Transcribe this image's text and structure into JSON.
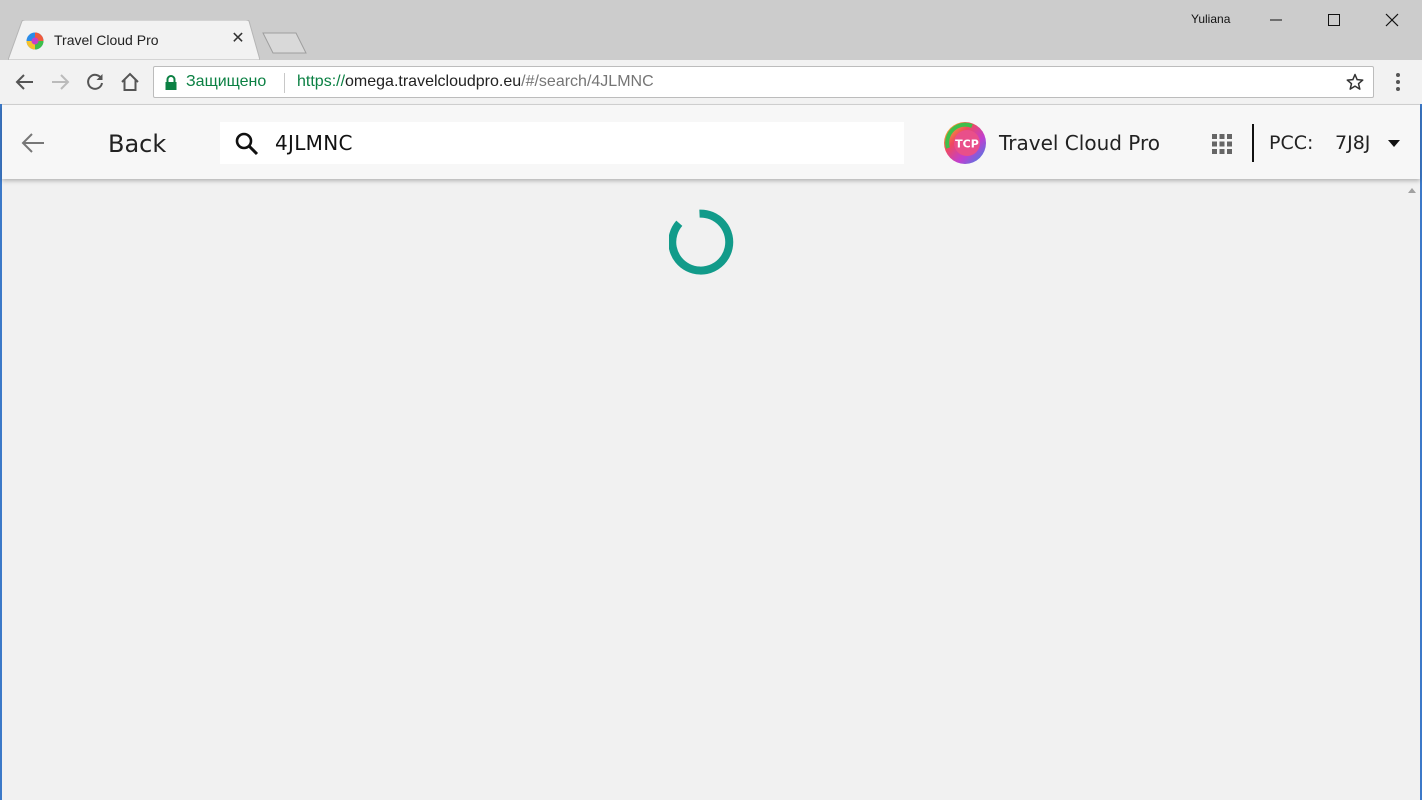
{
  "browser": {
    "tab_title": "Travel Cloud Pro",
    "profile_name": "Yuliana",
    "secure_label": "Защищено",
    "url_scheme": "https://",
    "url_host": "omega.travelcloudpro.eu",
    "url_path": "/#/search/4JLMNC"
  },
  "header": {
    "back_label": "Back",
    "search_value": "4JLMNC",
    "brand_name": "Travel Cloud Pro",
    "logo_text": "TCP",
    "pcc_label": "PCC:",
    "pcc_value": "7J8J"
  },
  "content": {
    "loading": true
  },
  "colors": {
    "spinner": "#129b8a",
    "secure": "#0b8043",
    "window_frame": "#3c79c8"
  },
  "icons": [
    "tab-favicon-icon",
    "close-icon",
    "minimize-icon",
    "maximize-icon",
    "window-close-icon",
    "back-icon",
    "forward-icon",
    "reload-icon",
    "home-icon",
    "lock-icon",
    "star-icon",
    "menu-icon",
    "arrow-left-icon",
    "search-icon",
    "apps-grid-icon",
    "caret-down-icon",
    "loading-spinner"
  ]
}
